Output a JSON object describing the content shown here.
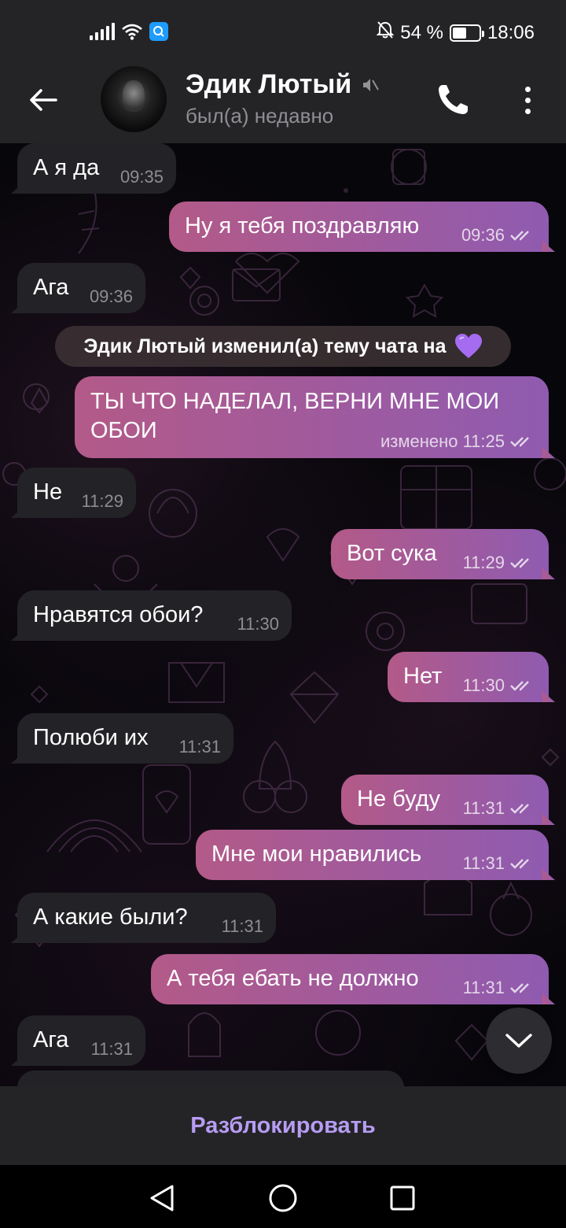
{
  "status_bar": {
    "battery": "54 %",
    "battery_level": 0.54,
    "time": "18:06",
    "icons": [
      "signal-icon",
      "wifi-icon",
      "qr-icon",
      "mute-alarm-icon",
      "battery-icon"
    ]
  },
  "header": {
    "name": "Эдик Лютый",
    "status": "был(а) недавно",
    "icons": [
      "back-arrow-icon",
      "muted-speaker-icon",
      "phone-icon",
      "more-vertical-icon"
    ]
  },
  "messages": [
    {
      "dir": "in",
      "text": "А я да",
      "time": "09:35"
    },
    {
      "dir": "out",
      "text": "Ну я тебя поздравляю",
      "time": "09:36"
    },
    {
      "dir": "in",
      "text": "Ага",
      "time": "09:36"
    },
    {
      "dir": "out",
      "text": "ТЫ ЧТО НАДЕЛАЛ, ВЕРНИ МНЕ МОИ ОБОИ",
      "time": "изменено 11:25"
    },
    {
      "dir": "in",
      "text": "Не",
      "time": "11:29"
    },
    {
      "dir": "out",
      "text": "Вот сука",
      "time": "11:29"
    },
    {
      "dir": "in",
      "text": "Нравятся обои?",
      "time": "11:30"
    },
    {
      "dir": "out",
      "text": "Нет",
      "time": "11:30"
    },
    {
      "dir": "in",
      "text": "Полюби их",
      "time": "11:31"
    },
    {
      "dir": "out",
      "text": "Не буду",
      "time": "11:31"
    },
    {
      "dir": "out",
      "text": "Мне мои нравились",
      "time": "11:31"
    },
    {
      "dir": "in",
      "text": "А какие были?",
      "time": "11:31"
    },
    {
      "dir": "out",
      "text": "А тебя ебать не должно",
      "time": "11:31"
    },
    {
      "dir": "in",
      "text": "Ага",
      "time": "11:31"
    }
  ],
  "service_message": {
    "text": "Эдик Лютый изменил(а) тему чата на",
    "emoji": "purple-heart"
  },
  "bottom": {
    "unblock_label": "Разблокировать"
  },
  "colors": {
    "accent": "#b79cf2",
    "outgoing_bubble_start": "#b35a88",
    "outgoing_bubble_end": "#8f5bb0",
    "incoming_bubble": "#232327",
    "bars": "#242427"
  }
}
